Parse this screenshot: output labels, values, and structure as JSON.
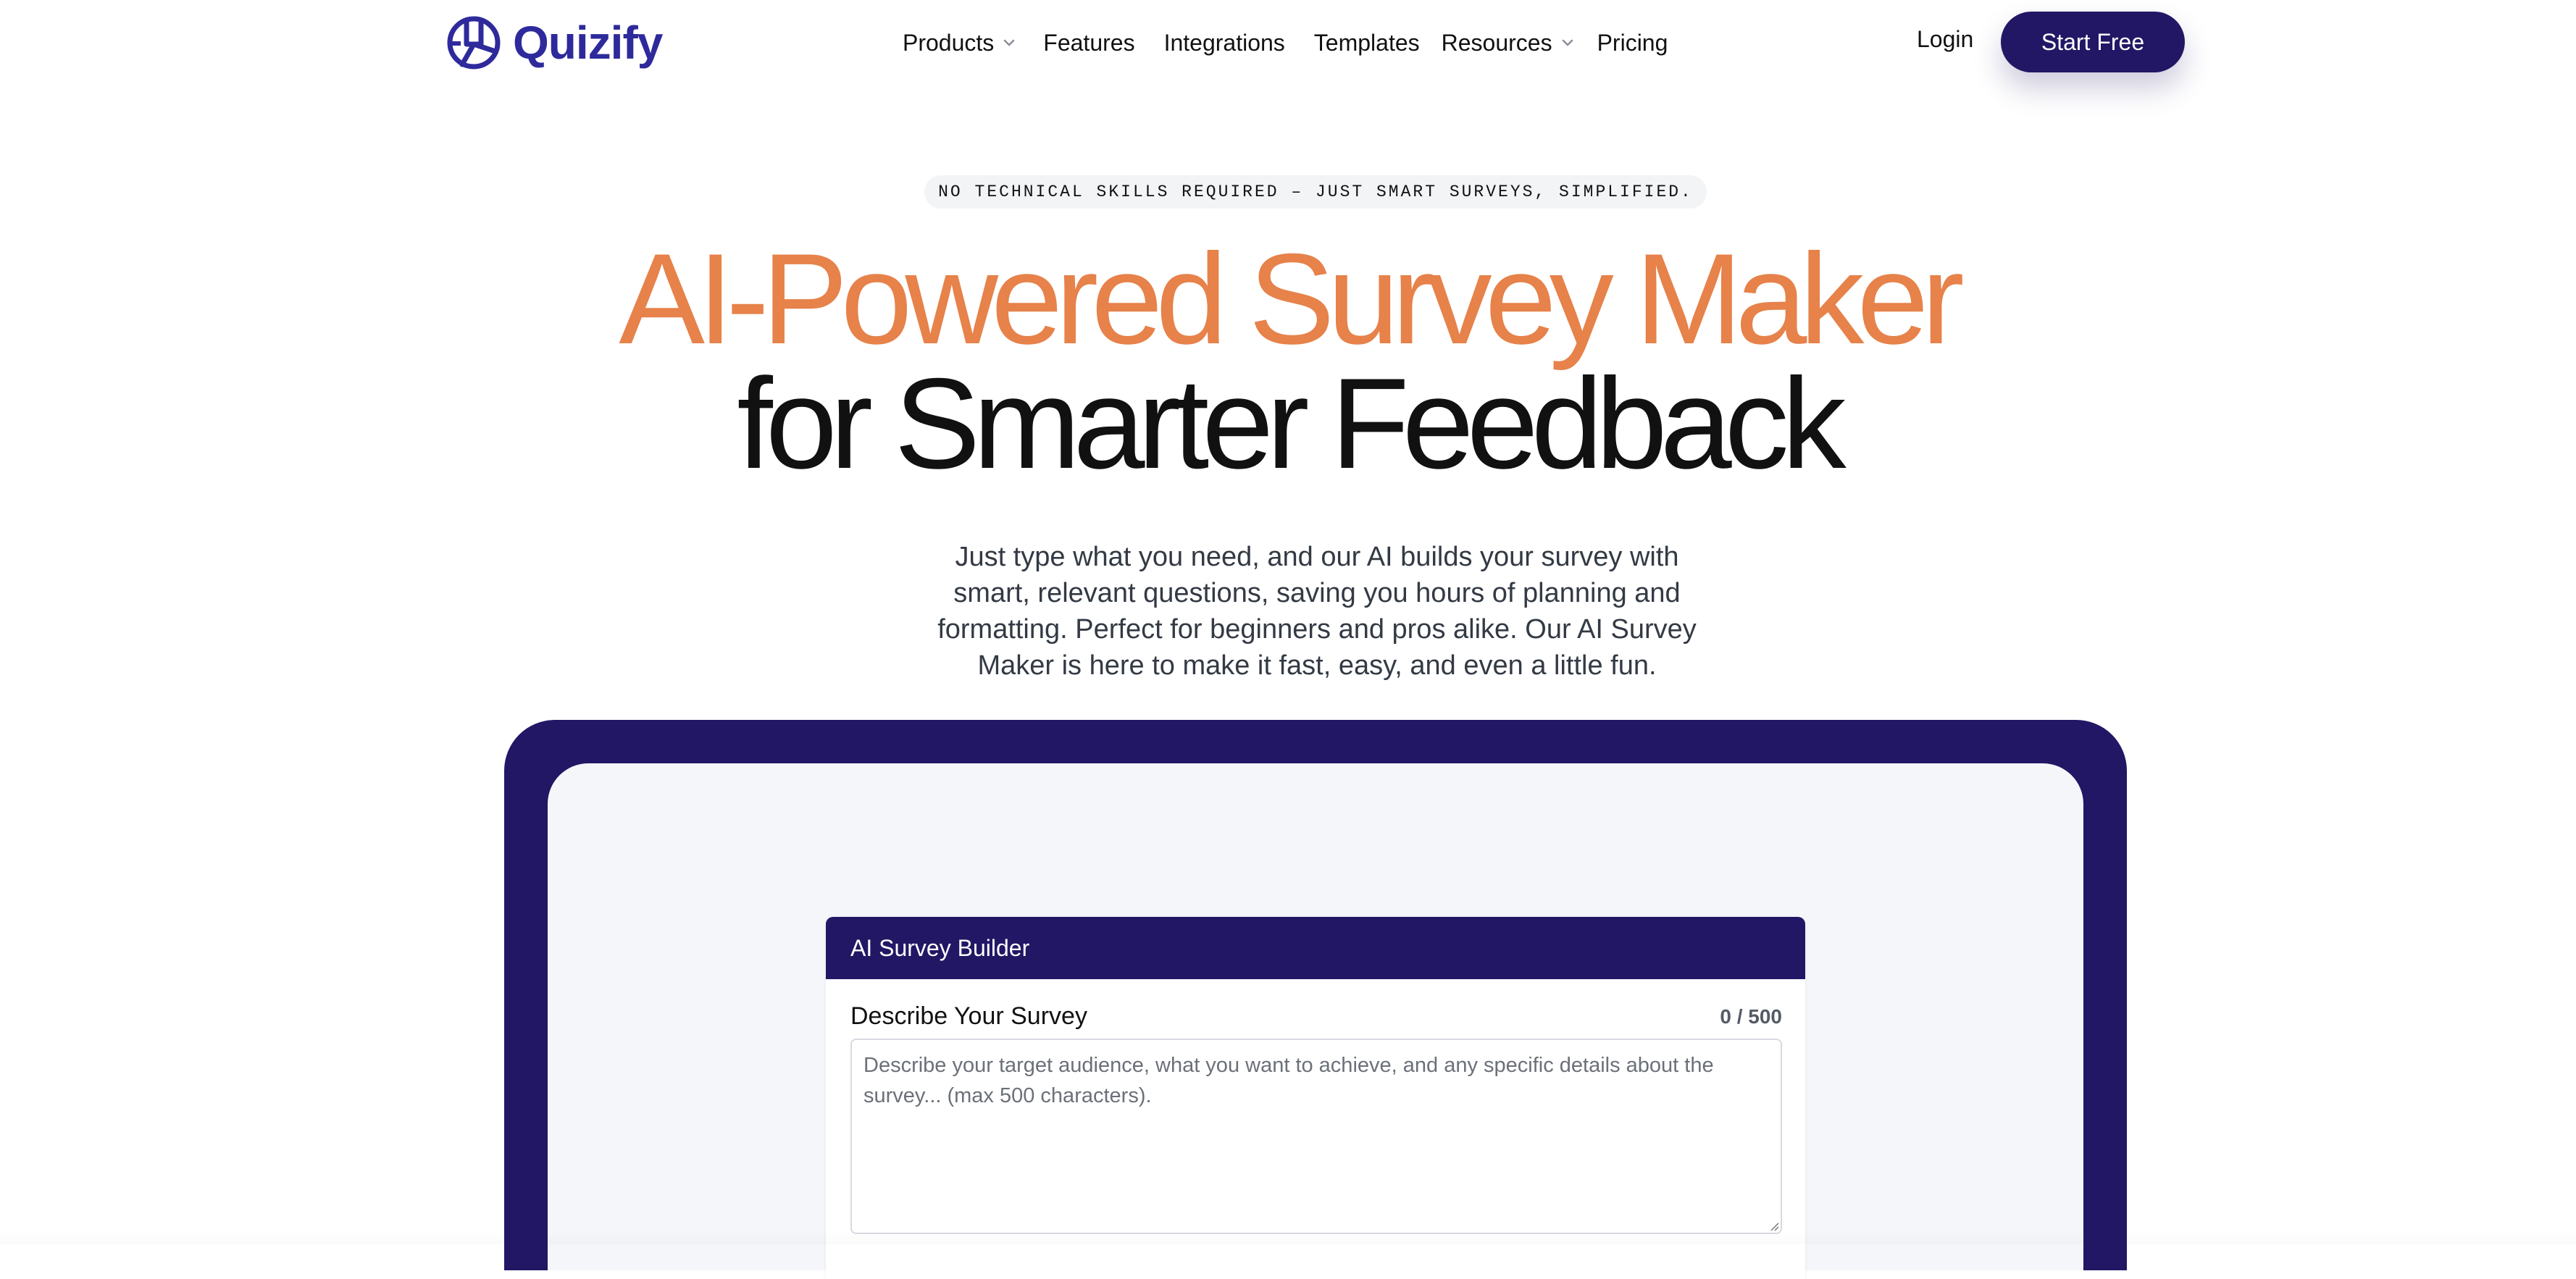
{
  "brand": {
    "name": "Quizify",
    "logo_icon": "quizify-logo-icon",
    "color": "#2e2a9c"
  },
  "nav": {
    "items": [
      {
        "label": "Products",
        "has_dropdown": true
      },
      {
        "label": "Features",
        "has_dropdown": false
      },
      {
        "label": "Integrations",
        "has_dropdown": false
      },
      {
        "label": "Templates",
        "has_dropdown": false
      },
      {
        "label": "Resources",
        "has_dropdown": true
      },
      {
        "label": "Pricing",
        "has_dropdown": false
      }
    ],
    "login_label": "Login",
    "cta_label": "Start Free"
  },
  "hero": {
    "tagline": "NO TECHNICAL SKILLS REQUIRED – JUST SMART SURVEYS, SIMPLIFIED.",
    "headline_line1": "AI-Powered Survey Maker",
    "headline_line2": "for Smarter Feedback",
    "description": "Just type what you need, and our AI builds your survey with smart, relevant questions, saving you hours of planning and formatting. Perfect for beginners and pros alike. Our AI Survey Maker is here to make it fast, easy, and even a little fun."
  },
  "builder": {
    "title": "AI Survey Builder",
    "field_label": "Describe Your Survey",
    "char_count": "0 / 500",
    "placeholder": "Describe your target audience, what you want to achieve, and any specific details about the survey... (max 500 characters).",
    "value": ""
  },
  "colors": {
    "accent_orange": "#e6824a",
    "primary_navy": "#221765",
    "screen_bg": "#f5f6fa"
  }
}
